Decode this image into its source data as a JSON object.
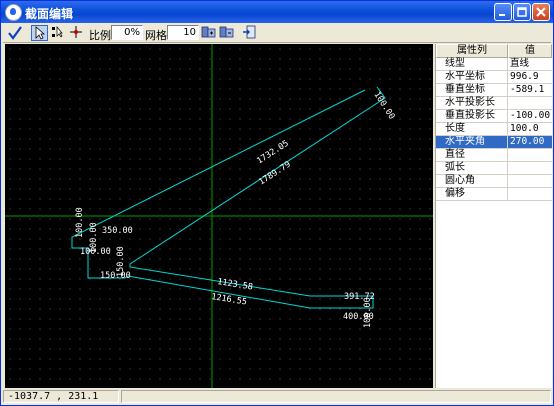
{
  "window": {
    "title": "截面编辑"
  },
  "toolbar": {
    "scale_label": "比例",
    "scale_value": "0%",
    "grid_label": "网格",
    "grid_value": "10"
  },
  "canvas": {
    "labels": [
      "1732.05",
      "1789.79",
      "100.00",
      "350.00",
      "100.00",
      "100.00",
      "1123.58",
      "150.00",
      "150.00",
      "1216.55",
      "391.72",
      "400.00",
      "100.00"
    ]
  },
  "properties": {
    "header_name": "属性列",
    "header_value": "值",
    "rows": [
      {
        "name": "线型",
        "value": "直线"
      },
      {
        "name": "水平坐标",
        "value": "996.9"
      },
      {
        "name": "垂直坐标",
        "value": "-589.1"
      },
      {
        "name": "水平投影长",
        "value": ""
      },
      {
        "name": "垂直投影长",
        "value": "-100.00"
      },
      {
        "name": "长度",
        "value": "100.0"
      },
      {
        "name": "水平夹角",
        "value": "270.00",
        "selected": true
      },
      {
        "name": "直径",
        "value": ""
      },
      {
        "name": "弧长",
        "value": ""
      },
      {
        "name": "圆心角",
        "value": ""
      },
      {
        "name": "偏移",
        "value": ""
      }
    ]
  },
  "status": {
    "coords": "-1037.7 , 231.1"
  },
  "colors": {
    "line": "#00d8d8",
    "label": "#ffffff",
    "crosshair": "#00a000",
    "selection": "#316ac5"
  }
}
